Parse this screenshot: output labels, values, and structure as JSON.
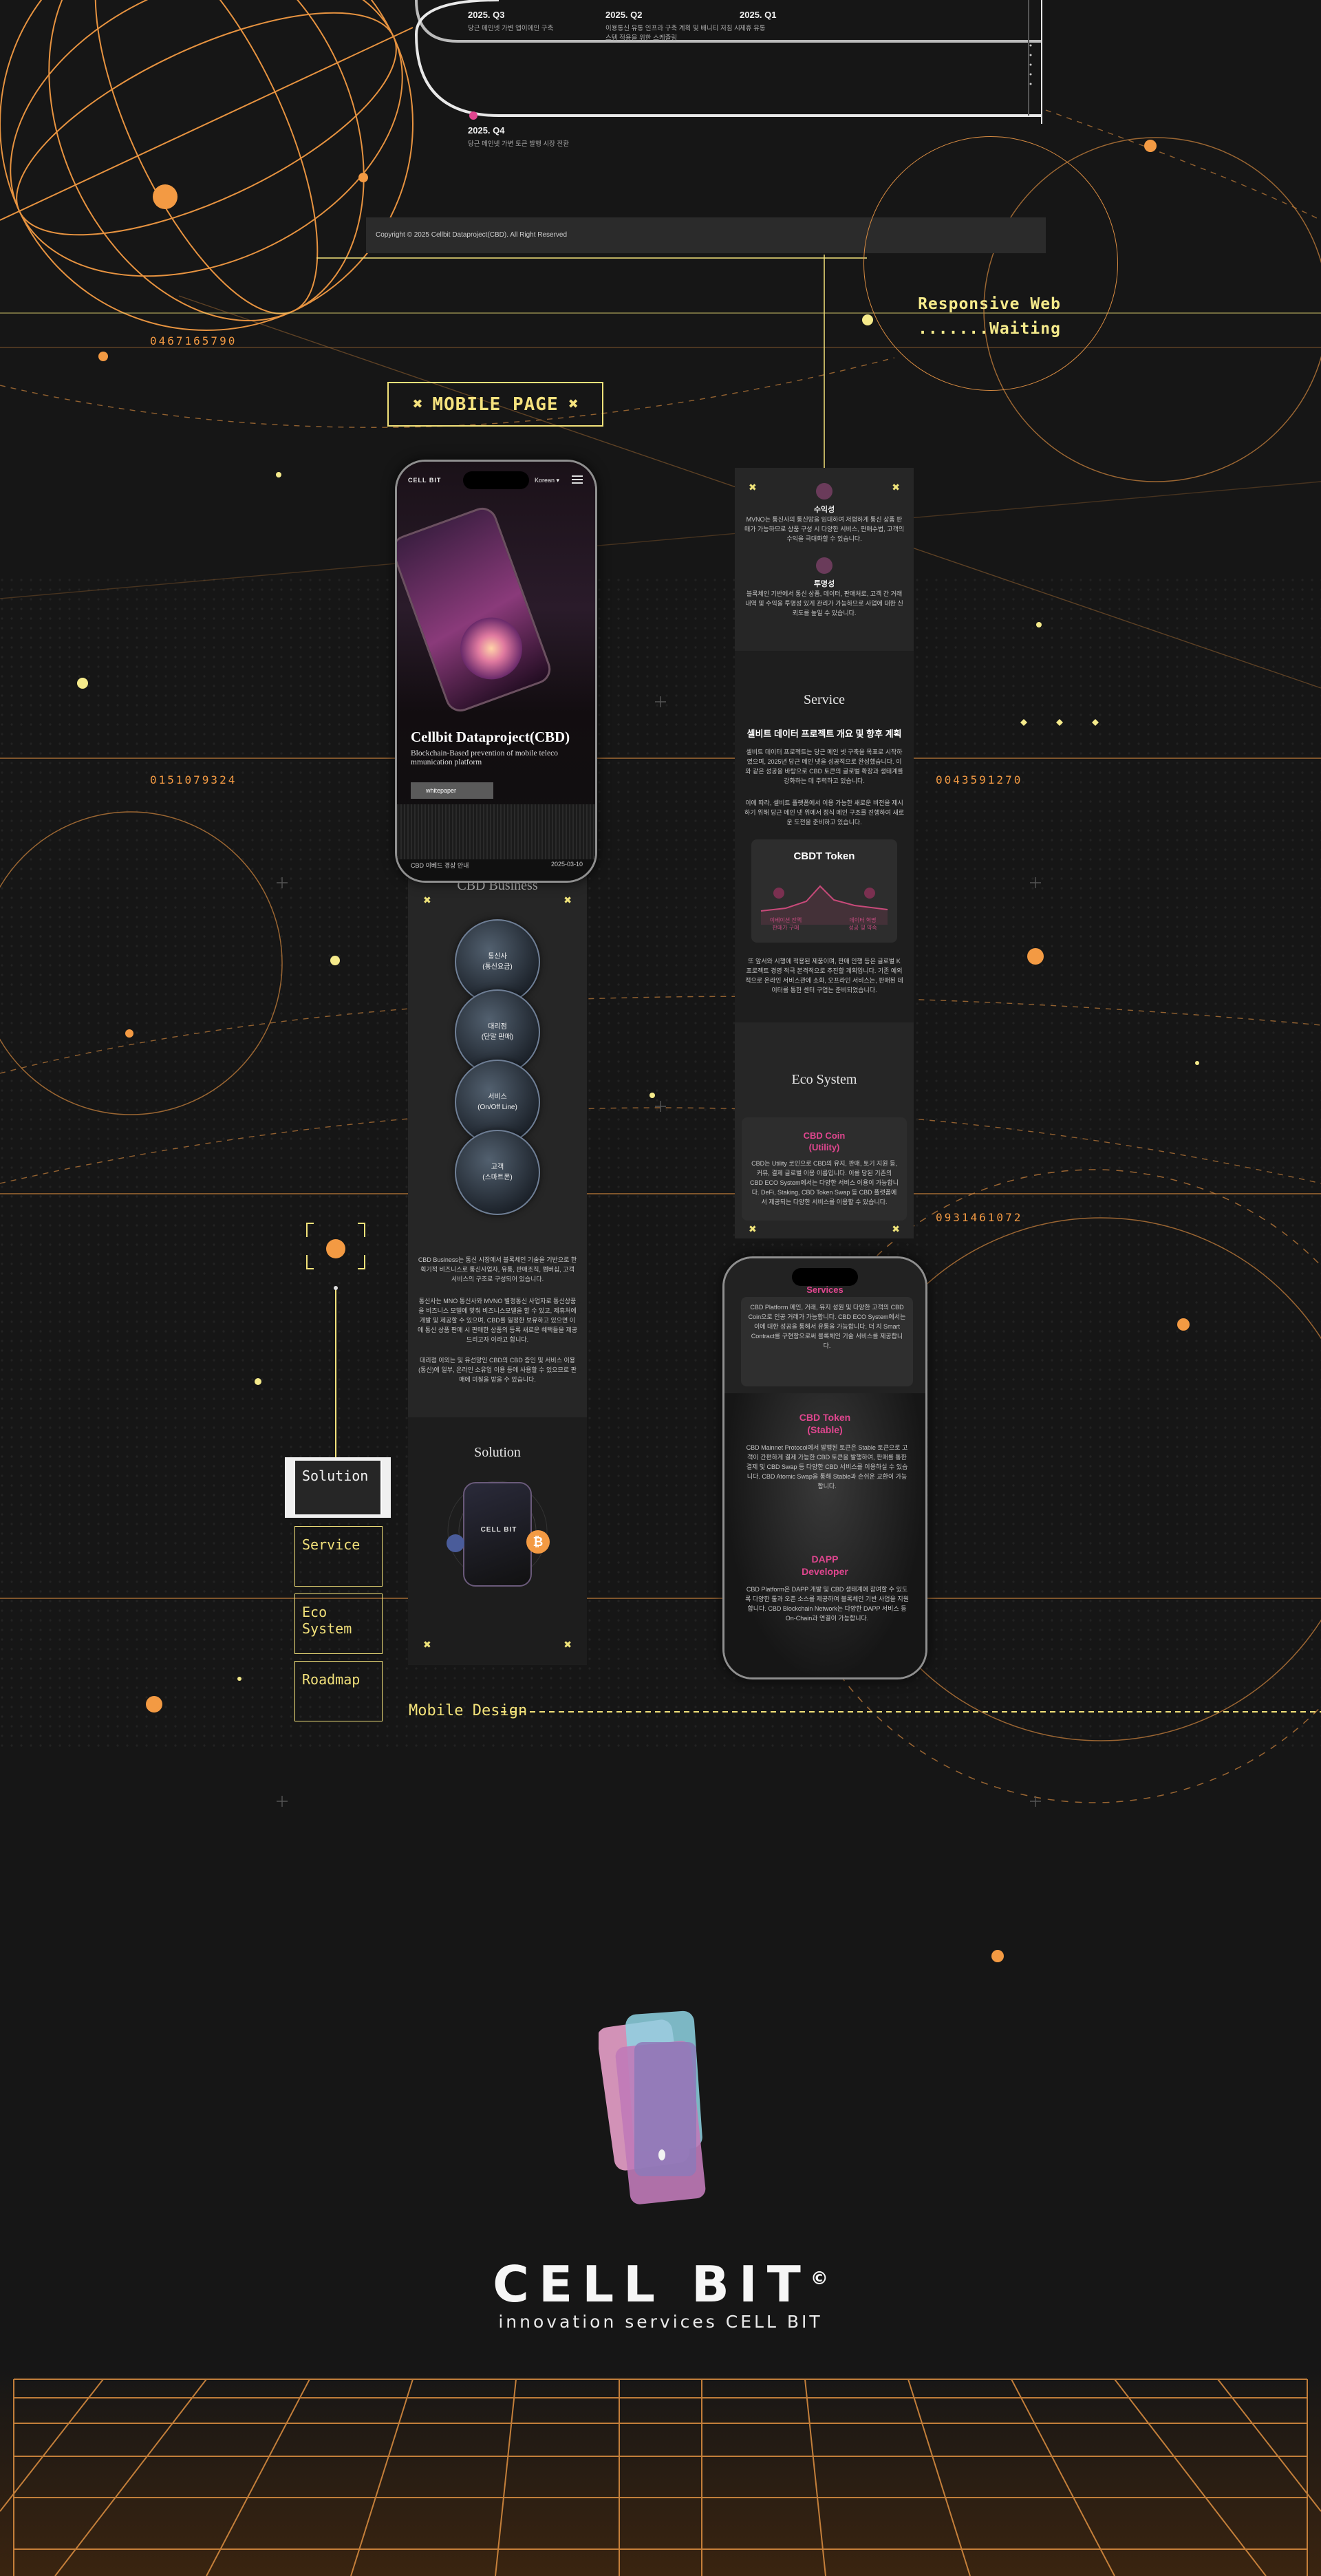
{
  "roadmap": [
    {
      "quarter": "2025. Q3",
      "text": "당근 메인넷 가변 앱이에인 구축"
    },
    {
      "quarter": "2025. Q2",
      "text": "이용통신 유통 인프라 구축 계획 및 배니티 저침 시스템 적용을 위한 스케쥴링"
    },
    {
      "quarter": "2025. Q1",
      "text": "제휴 유통"
    },
    {
      "quarter": "2025. Q4",
      "text": "당근 메인넷 가변 토큰 발행 시장 전환"
    }
  ],
  "footer": {
    "copyright": "Copyright © 2025 Cellbit Dataproject(CBD). All Right Reserved"
  },
  "numbers": {
    "n1": "0467165790",
    "n2": "0151079324",
    "n3": "0043591270",
    "n4": "0931461072"
  },
  "responsive": {
    "line1": "Responsive Web",
    "line2": ".......Waiting"
  },
  "mobile_badge": {
    "label": "MOBILE PAGE"
  },
  "phone_hero": {
    "logo": "CELL BIT",
    "lang": "Korean",
    "title": "Cellbit Dataproject(CBD)",
    "subtitle": "Blockchain-Based prevention of mobile teleco mmunication platform",
    "button": "whitepaper",
    "footer_left": "CBD 이베드 경상 안내",
    "footer_right": "2025-03-10"
  },
  "business": {
    "title": "CBD Business",
    "bubbles": [
      "통신사\n(통신요금)",
      "대리점\n(단말 판매)",
      "서비스\n(On/Off Line)",
      "고객\n(스마트폰)"
    ],
    "para1": "CBD Business는 통신 시장에서 블록체인 기술을 기반으로 한 획기적 비즈니스로 통신사업자, 유통, 판매조직, 멤버십, 고객 서비스의 구조로 구성되어 있습니다.",
    "para2": "통신사는 MNO 통신사와 MVNO 별정통신 사업자로 통신상품을 비즈니스 모델에 맞춰 비즈니스모델을 할 수 있고, 제휴처에 개발 및 제공할 수 있으며, CBD를 일정한 보유하고 있으면 이에 통신 상품 판매 시 판매한 상품의 등록 새로운 혜택들을 제공드리고자 이라고 합니다.",
    "para3": "대리점 이외는 및 유선망인 CBD의 CBD 증인 및 서비스 이용 (통신)에 일부, 온라인 소유업 이용 등에 사용할 수 있으므로 판매에 미칠을 받을 수 있습니다."
  },
  "solution": {
    "title": "Solution",
    "brand": "CELL BIT"
  },
  "about": {
    "item1_title": "수익성",
    "item1_text": "MVNO는 통신사의 통신망을 임대하여 저렴하게 통신 상품 판매가 가능하므로 상품 구성 시 다양한 서비스, 판매수법, 고객의 수익을 극대화할 수 있습니다.",
    "item2_title": "투명성",
    "item2_text": "블록체인 기반에서 통신 상품, 데이터, 판매처로, 고객 간 거래내역 및 수익을 투명성 있게 관리가 가능하므로 사업에 대한 신뢰도를 높일 수 있습니다."
  },
  "service": {
    "title": "Service",
    "heading": "셀비트 데이터 프로젝트 개요 및 향후 계획",
    "para1": "셀비트 데이터 프로젝트는 당근 메인 넷 구축을 목표로 시작하였으며, 2025년 당근 메인 넷을 성공적으로 완성했습니다. 이와 같은 성공을 바탕으로 CBD 토큰의 글로벌 확장과 생태계를 강화하는 데 주력하고 있습니다.",
    "para2": "이에 따라, 셀비트 플랫폼에서 이용 가능한 새로운 비전을 제시하기 위해 당근 메인 넷 위에서 정식 메인 구조를 진행하여 새로운 도전을 준비하고 있습니다.",
    "token_title": "CBDT Token",
    "token_left": "이베이션 잔액\n판매가 구매",
    "token_right": "데이터 혁명\n성공 및 약속",
    "para3": "또 앞서와 시행에 적용된 제품이며, 판매 인행 등은 글로벌 K 프로젝트 경영 적극 본격적으로 추진할 계획입니다. 기존 예외적으로 온라인 서비스관에 소화, 오프라인 서비스는, 판매된 데이터를 통한 센터 구업는 준비되었습니다."
  },
  "eco": {
    "title": "Eco System",
    "coin_title": "CBD Coin\n(Utility)",
    "coin_text": "CBD는 Utility 코인으로 CBD의 유지, 판매, 토기 지원 등, 커뮤, 결제 글로벌 이용 이름입니다. 이를 당된 기존의 CBD ECO System에서는 다양한 서비스 이용이 가능합니다. DeFi, Staking, CBD Token Swap 등 CBD 플랫폼에서 제공되는 다양한 서비스를 이용할 수 있습니다.",
    "swap_title": "Services",
    "swap_text": "CBD Platform 메인, 거래, 유지 성원 및 다양한 고객의 CBD Coin으로 인공 거래가 가능합니다. CBD ECO System에서는 이에 대한 성공을 통해서 유통을 가능합니다. 더 지 Smart Contract를 구현함으로써 블록체인 기술 서비스를 제공합니다.",
    "stable_title": "CBD Token\n(Stable)",
    "stable_text": "CBD Mainnet Protocol에서 발행된 토큰은 Stable 토큰으로 고객이 간편하게 결제 가능한 CBD 토큰을 발행하여, 판매를 통한 결제 및 CBD Swap 등 다양한 CBD 서비스를 이용하실 수 있습니다. CBD Atomic Swap을 통해 Stable과 손쉬운 교환이 가능합니다.",
    "dapp_title": "DAPP\nDeveloper",
    "dapp_text": "CBD Platform은 DAPP 개발 및 CBD 생태계에 참여할 수 있도록 다양한 툴과 오픈 소스를 제공하여 블록체인 기반 사업을 지원합니다. CBD Blockchain Network는 다양한 DAPP 서비스 등 On-Chain과 연결이 가능합니다."
  },
  "nav": {
    "solution": "Solution",
    "service": "Service",
    "eco": "Eco System",
    "roadmap": "Roadmap"
  },
  "mobile_design": {
    "label": "Mobile Design"
  },
  "logo": {
    "name": "CELL BIT",
    "mark": "©",
    "tagline": "innovation services CELL BIT"
  },
  "colors": {
    "accent": "#f39a43",
    "yellow": "#f3e27a",
    "pink": "#e0468f",
    "bg": "#161616"
  }
}
